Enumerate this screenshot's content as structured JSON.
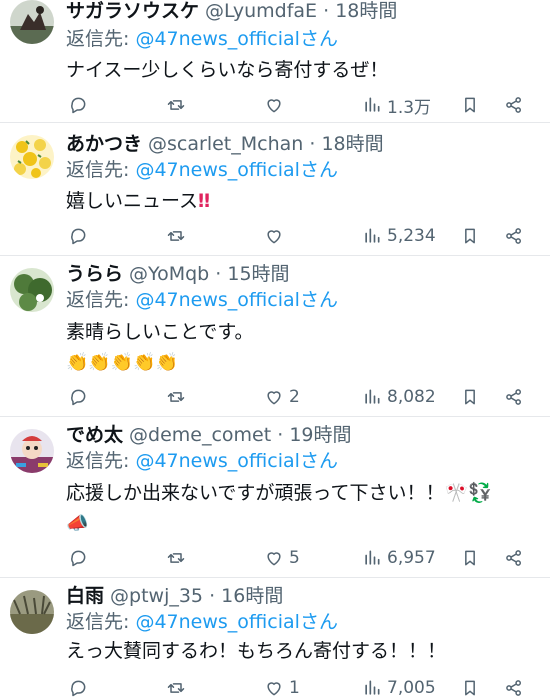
{
  "replies": [
    {
      "name": "サガラソウスケ",
      "handle": "@LyumdfaE",
      "sep": " · ",
      "time": "18時間",
      "reply_label": "返信先: ",
      "reply_to": "@47news_officialさん",
      "text": "ナイスー少しくらいなら寄付するぜ！",
      "likes": "",
      "views": "1.3万",
      "avatar_color": "#5b6b52"
    },
    {
      "name": "あかつき",
      "handle": "@scarlet_Mchan",
      "sep": " · ",
      "time": "18時間",
      "reply_label": "返信先: ",
      "reply_to": "@47news_officialさん",
      "text": "嬉しいニュース",
      "likes": "",
      "views": "5,234",
      "avatar_color": "#f3d34a"
    },
    {
      "name": "うらら",
      "handle": "@YoMqb",
      "sep": " · ",
      "time": "15時間",
      "reply_label": "返信先: ",
      "reply_to": "@47news_officialさん",
      "text": "素晴らしいことです。",
      "text2": "👏👏👏👏👏",
      "likes": "2",
      "views": "8,082",
      "avatar_color": "#4f7a3a"
    },
    {
      "name": "でめ太",
      "handle": "@deme_comet",
      "sep": " · ",
      "time": "19時間",
      "reply_label": "返信先: ",
      "reply_to": "@47news_officialさん",
      "text": "応援しか出来ないですが頑張って下さい！！🎌💱",
      "text2": "📣",
      "likes": "5",
      "views": "6,957",
      "avatar_color": "#8a3b6b"
    },
    {
      "name": "白雨",
      "handle": "@ptwj_35",
      "sep": " · ",
      "time": "16時間",
      "reply_label": "返信先: ",
      "reply_to": "@47news_officialさん",
      "text": "えっ大賛同するわ！もちろん寄付する！！！",
      "likes": "1",
      "views": "7,005",
      "avatar_color": "#6b6a4a"
    }
  ],
  "colors": {
    "text": "#0f1419",
    "muted": "#536471",
    "link": "#1d9bf0",
    "divider": "#e6e8eb"
  },
  "icons": [
    "reply-icon",
    "retweet-icon",
    "like-icon",
    "views-icon",
    "bookmark-icon",
    "share-icon"
  ]
}
